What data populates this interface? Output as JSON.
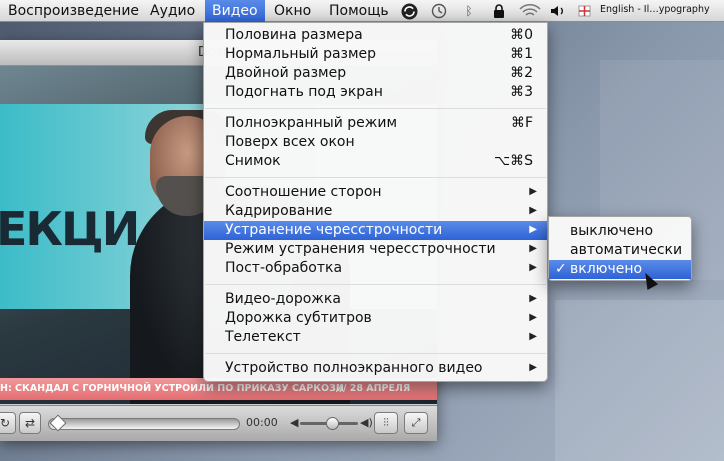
{
  "menubar": {
    "items": [
      "Воспроизведение",
      "Аудио",
      "Видео",
      "Окно",
      "Помощь"
    ],
    "active_index": 2,
    "input_source": "English - Il…ypography"
  },
  "player": {
    "title": "Dozhd",
    "ticker_text": "Н: СКАНДАЛ С  ГОРНИЧНОЙ УСТРОИЛИ ПО ПРИКАЗУ САРКОЗИ",
    "ticker_date": "/// 28 АПРЕЛЯ",
    "screen_text": "ЕКЦИ",
    "time": "00:00",
    "seek_fraction": 0.0,
    "volume_fraction": 0.5
  },
  "menu": {
    "items": [
      {
        "label": "Половина размера",
        "shortcut": "⌘0"
      },
      {
        "label": "Нормальный размер",
        "shortcut": "⌘1"
      },
      {
        "label": "Двойной размер",
        "shortcut": "⌘2"
      },
      {
        "label": "Подогнать под экран",
        "shortcut": "⌘3"
      },
      {
        "label": "Полноэкранный режим",
        "shortcut": "⌘F"
      },
      {
        "label": "Поверх всех окон",
        "shortcut": ""
      },
      {
        "label": "Снимок",
        "shortcut": "⌥⌘S"
      },
      {
        "label": "Соотношение сторон",
        "submenu": true
      },
      {
        "label": "Кадрирование",
        "submenu": true
      },
      {
        "label": "Устранение чересстрочности",
        "submenu": true
      },
      {
        "label": "Режим устранения чересстрочности",
        "submenu": true
      },
      {
        "label": "Пост-обработка",
        "submenu": true
      },
      {
        "label": "Видео-дорожка",
        "submenu": true
      },
      {
        "label": "Дорожка субтитров",
        "submenu": true
      },
      {
        "label": "Телетекст",
        "submenu": true
      },
      {
        "label": "Устройство полноэкранного видео",
        "submenu": true
      }
    ],
    "highlighted_index": 9
  },
  "submenu": {
    "items": [
      {
        "label": "выключено",
        "checked": false
      },
      {
        "label": "автоматически",
        "checked": false
      },
      {
        "label": "включено",
        "checked": true
      }
    ],
    "highlighted_index": 2,
    "check_mark": "✓"
  }
}
